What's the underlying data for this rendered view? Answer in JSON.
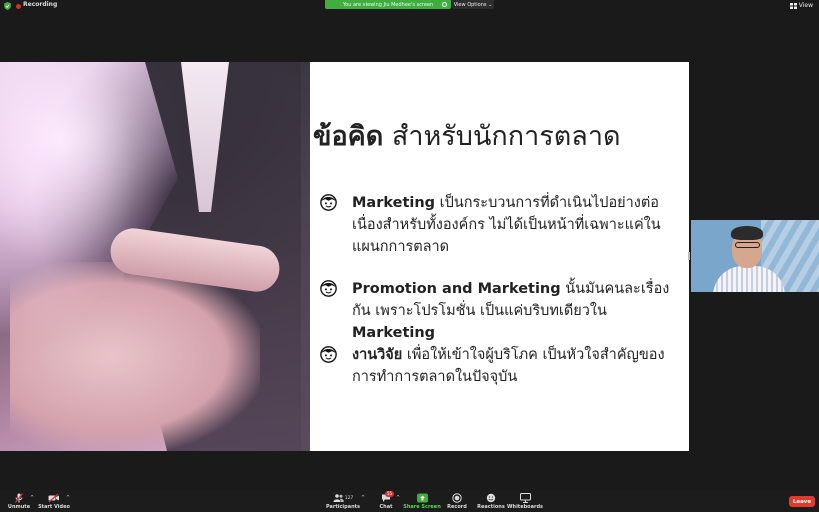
{
  "top_bar": {
    "recording_label": "Recording",
    "viewing_banner": "You are viewing Jiu Medhee's screen",
    "view_options_label": "View Options",
    "view_label": "View"
  },
  "slide": {
    "title_bold": "ข้อคิด",
    "title_rest": " สำหรับนักการตลาด",
    "bullets": [
      {
        "bold": "Marketing",
        "rest": " เป็นกระบวนการที่ดำเนินไปอย่างต่อเนื่องสำหรับทั้งองค์กร ไม่ได้เป็นหน้าที่เฉพาะแค่ในแผนกการตลาด"
      },
      {
        "bold": "Promotion and Marketing",
        "rest": " นั้นมันคนละเรื่องกัน เพราะโปรโมชั่น เป็นแค่บริบทเดียวใน ",
        "bold2": "Marketing"
      },
      {
        "bold": "งานวิจัย",
        "rest": " เพื่อให้เข้าใจผู้บริโภค เป็นหัวใจสำคัญของการทำการตลาดในปัจจุบัน"
      }
    ]
  },
  "toolbar": {
    "unmute_label": "Unmute",
    "start_video_label": "Start Video",
    "participants_label": "Participants",
    "participants_count": "127",
    "chat_label": "Chat",
    "chat_badge": "55",
    "share_screen_label": "Share Screen",
    "record_label": "Record",
    "reactions_label": "Reactions",
    "whiteboards_label": "Whiteboards",
    "leave_label": "Leave"
  },
  "colors": {
    "share_green": "#3fae3f",
    "leave_red": "#e03a2e",
    "recording_red": "#e02828"
  }
}
